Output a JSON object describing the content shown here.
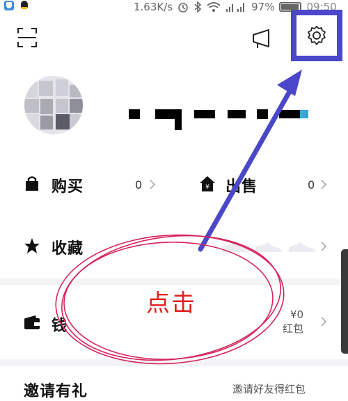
{
  "status_bar": {
    "speed": "1.63K/s",
    "battery_percent": "97%",
    "time": "09:50",
    "icons": [
      "app-shield-icon",
      "qq-icon",
      "alarm-icon",
      "bluetooth-icon",
      "wifi-icon",
      "signal-icon",
      "battery-icon"
    ]
  },
  "header": {
    "scan": "scan-icon",
    "notice": "notice-icon",
    "settings": "settings-gear-icon"
  },
  "rows": {
    "buy": {
      "label": "购买",
      "count": "0"
    },
    "sell": {
      "label": "出售",
      "count": "0"
    },
    "favorites": {
      "label": "收藏"
    },
    "wallet": {
      "label": "钱",
      "amount": "¥0",
      "sub": "红包"
    },
    "invite": {
      "label": "邀请有礼",
      "right": "邀请好友得红包"
    }
  },
  "annotation": {
    "text": "点击",
    "arrow_color": "#4a47c8",
    "circle_color": "#d6245a"
  },
  "colors": {
    "accent_box": "#4a47c8",
    "annotation_red": "#e0201c"
  }
}
